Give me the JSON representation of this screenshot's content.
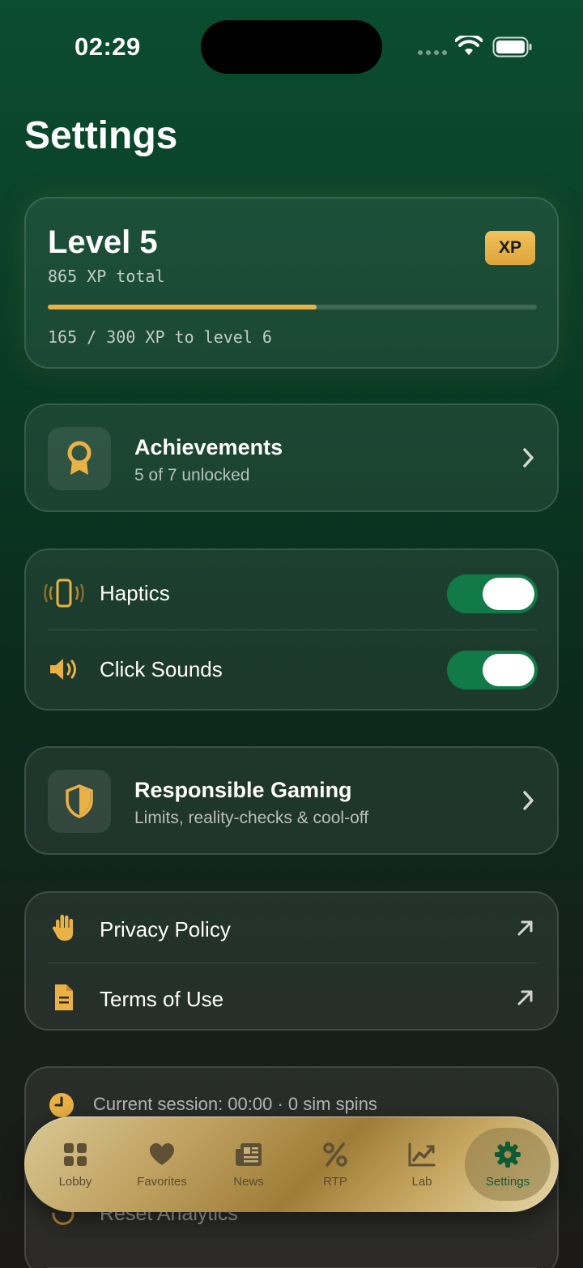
{
  "status": {
    "time": "02:29"
  },
  "page": {
    "title": "Settings"
  },
  "level": {
    "title": "Level 5",
    "xp_total": "865 XP total",
    "badge": "XP",
    "progress_fraction": 0.55,
    "progress_text": "165 / 300 XP to level 6"
  },
  "achievements": {
    "title": "Achievements",
    "subtitle": "5 of 7 unlocked"
  },
  "toggles": [
    {
      "label": "Haptics",
      "icon": "vibration-phone-icon",
      "on": true
    },
    {
      "label": "Click Sounds",
      "icon": "speaker-icon",
      "on": true
    }
  ],
  "responsible": {
    "title": "Responsible Gaming",
    "subtitle": "Limits, reality-checks & cool-off"
  },
  "links": [
    {
      "label": "Privacy Policy",
      "icon": "hand-icon"
    },
    {
      "label": "Terms of Use",
      "icon": "document-icon"
    }
  ],
  "session": {
    "text": "Current session: 00:00 · 0 sim spins",
    "reset_label": "Reset Analytics"
  },
  "tabs": [
    {
      "label": "Lobby",
      "icon": "grid-icon"
    },
    {
      "label": "Favorites",
      "icon": "heart-icon"
    },
    {
      "label": "News",
      "icon": "newspaper-icon"
    },
    {
      "label": "RTP",
      "icon": "percent-icon"
    },
    {
      "label": "Lab",
      "icon": "chart-icon"
    },
    {
      "label": "Settings",
      "icon": "gear-icon",
      "active": true
    }
  ],
  "colors": {
    "accent_gold": "#eab146",
    "toggle_green": "#127a47",
    "active_tab_text": "#0f5a34"
  }
}
